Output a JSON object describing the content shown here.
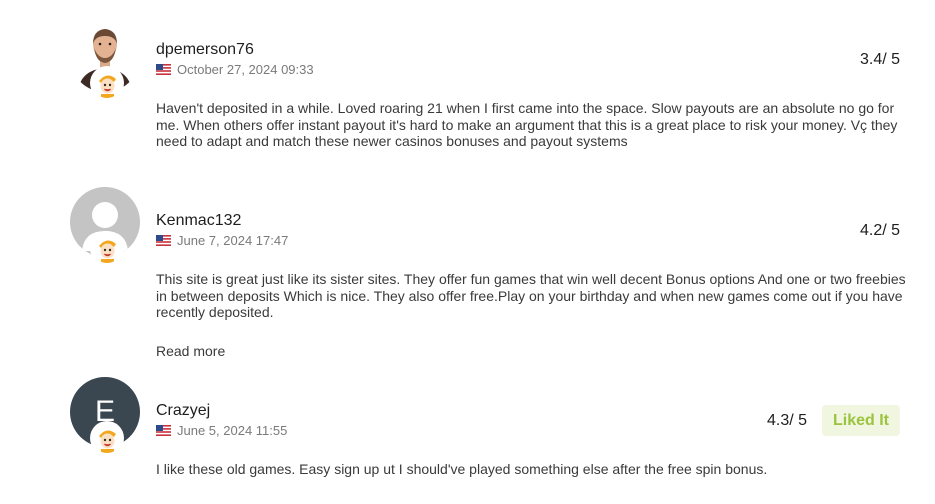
{
  "reviews": [
    {
      "username": "dpemerson76",
      "date": "October 27, 2024 09:33",
      "rating": "3.4/ 5",
      "text": "Haven't deposited in a while. Loved roaring 21 when I first came into the space. Slow payouts are an absolute no go for me. When others offer instant payout it's hard to make an argument that this is a great place to risk your money. Vç they need to adapt and match these newer casinos bonuses and payout systems",
      "avatar_icon": "man-photo-avatar",
      "flag_icon": "us-flag-icon"
    },
    {
      "username": "Kenmac132",
      "date": "June 7, 2024 17:47",
      "rating": "4.2/ 5",
      "text": "This site is great just like its sister sites. They offer fun games that win well decent Bonus options And one or two freebies in between deposits Which is nice. They also offer free.Play on your birthday and when new games come out if you have recently deposited.",
      "read_more": "Read more",
      "avatar_icon": "default-user-avatar",
      "flag_icon": "us-flag-icon"
    },
    {
      "username": "Crazyej",
      "date": "June 5, 2024 11:55",
      "rating": "4.3/ 5",
      "liked_label": "Liked It",
      "text": "I like these old games. Easy sign up ut I should've played something else after the free spin bonus.",
      "avatar_letter": "E",
      "flag_icon": "us-flag-icon"
    }
  ],
  "colors": {
    "liked_bg": "#f0f6e0",
    "liked_text": "#9bc33e",
    "letter_avatar_bg": "#3a4750"
  }
}
